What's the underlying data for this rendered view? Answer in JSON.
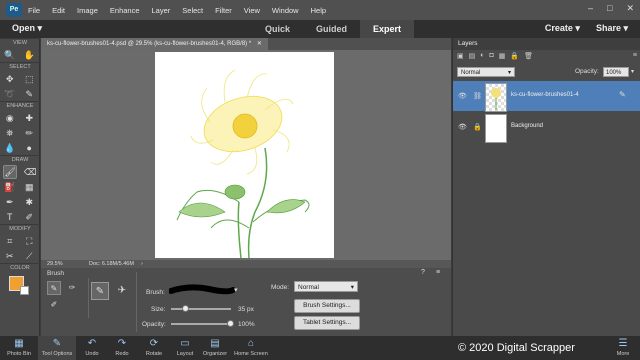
{
  "menu": [
    "File",
    "Edit",
    "Image",
    "Enhance",
    "Layer",
    "Select",
    "Filter",
    "View",
    "Window",
    "Help"
  ],
  "mode_bar": {
    "open": "Open",
    "modes": [
      "Quick",
      "Guided",
      "Expert"
    ],
    "active": "Expert",
    "create": "Create",
    "share": "Share"
  },
  "toolbox": {
    "sections": [
      "VIEW",
      "SELECT",
      "ENHANCE",
      "DRAW",
      "MODIFY",
      "COLOR"
    ],
    "foreground_color": "#f0a030"
  },
  "document": {
    "tab_title": "ks-cu-flower-brushes01-4.psd @ 29.5% (ks-cu-flower-brushes01-4, RGB/8) *",
    "zoom": "29.5%",
    "doc_size": "Doc: 6.18M/5.46M"
  },
  "tool_options": {
    "tool_name": "Brush",
    "brush_label": "Brush:",
    "size_label": "Size:",
    "size_value": "35 px",
    "size_fraction": 0.25,
    "opacity_label": "Opacity:",
    "opacity_value": "100%",
    "opacity_fraction": 1.0,
    "mode_label": "Mode:",
    "mode_value": "Normal",
    "brush_settings": "Brush Settings...",
    "tablet_settings": "Tablet Settings..."
  },
  "layers_panel": {
    "title": "Layers",
    "blend_mode": "Normal",
    "opacity_label": "Opacity:",
    "opacity_value": "100%",
    "layers": [
      {
        "name": "ks-cu-flower-brushes01-4",
        "selected": true
      },
      {
        "name": "Background",
        "selected": false
      }
    ]
  },
  "taskbar": {
    "items": [
      "Photo Bin",
      "Tool Options",
      "Undo",
      "Redo",
      "Rotate",
      "Layout",
      "Organizer",
      "Home Screen"
    ],
    "more": "More"
  },
  "watermark": "© 2020 Digital Scrapper",
  "colors": {
    "accent": "#4d86c6",
    "selected_layer": "#4f7fb8"
  }
}
